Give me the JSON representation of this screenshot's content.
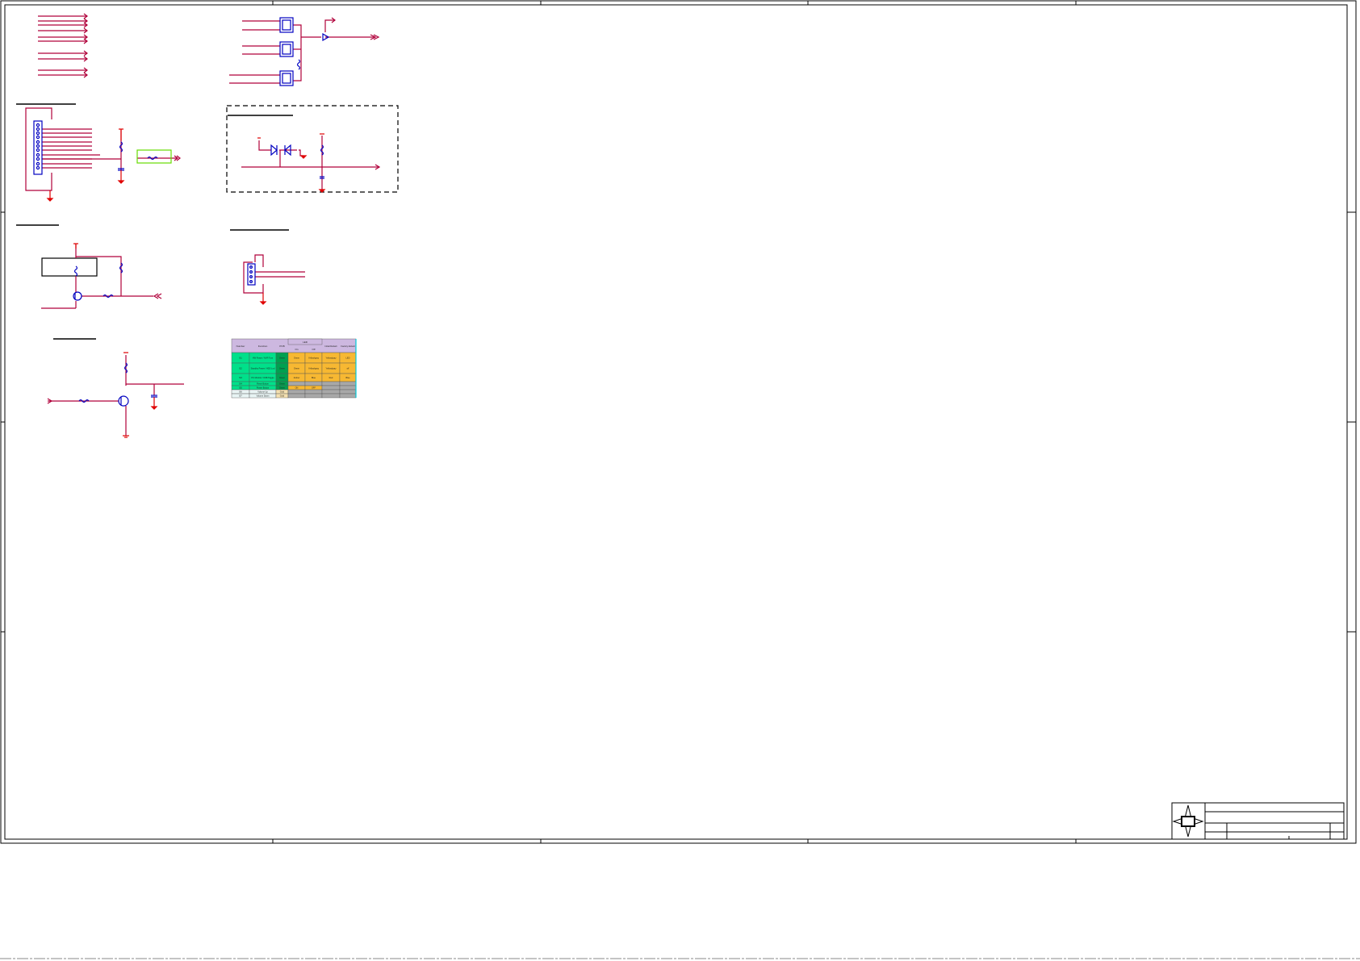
{
  "sheet": {
    "title": "",
    "frame_color": "#000000",
    "wire_color": "#b0003a",
    "power_color": "#e00000",
    "component_color": "#0000c0"
  },
  "led_table": {
    "header": {
      "number": "Number",
      "function": "Function",
      "pcb": "PCB",
      "led_group": "LED",
      "on": "On",
      "off": "Off",
      "initial": "Initial Default",
      "factory": "Factory default"
    },
    "rows": [
      {
        "number": "S1",
        "function": "HW Power / NVR Turn",
        "pcb": "Green",
        "on": "Green",
        "off": "Yellow/gray",
        "initial": "Yellow/gray",
        "factory": "LED"
      },
      {
        "number": "S2",
        "function": "Standby Power / HDD Led",
        "pcb": "Green",
        "on": "Green",
        "off": "Yellow/gray",
        "initial": "Yellow/gray",
        "factory": "off"
      },
      {
        "number": "S3",
        "function": "PC Monitor / USB Toggle",
        "pcb": "Green",
        "on": "Amber",
        "off": "Blue",
        "initial": "Red",
        "factory": "Blue"
      },
      {
        "number": "S4",
        "function": "Reset Button",
        "pcb": "Green",
        "on": "",
        "off": "",
        "initial": "",
        "factory": ""
      },
      {
        "number": "S5",
        "function": "Power Button",
        "pcb": "Green",
        "on": "ON",
        "off": "OFF",
        "initial": "",
        "factory": ""
      },
      {
        "number": "S6",
        "function": "Volume Up",
        "pcb": "Gold",
        "on": "",
        "off": "",
        "initial": "",
        "factory": ""
      },
      {
        "number": "S7",
        "function": "Volume Down",
        "pcb": "Gold",
        "on": "",
        "off": "",
        "initial": "",
        "factory": ""
      }
    ]
  }
}
